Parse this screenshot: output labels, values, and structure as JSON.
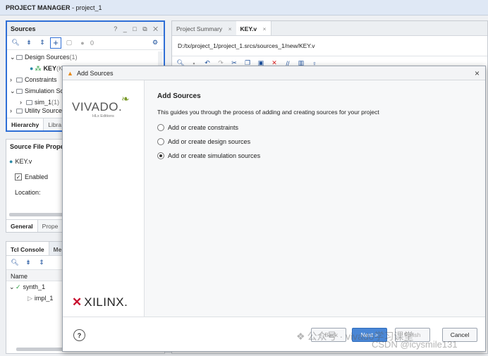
{
  "titlebar": {
    "app": "PROJECT MANAGER",
    "project": " - project_1"
  },
  "sources": {
    "title": "Sources",
    "header_icons": [
      "?",
      "_",
      "□",
      "⧉",
      "✕"
    ],
    "badge_count": "0",
    "tree": [
      {
        "label": "Design Sources",
        "suffix": " (1)"
      },
      {
        "label": "KEY",
        "suffix": " (K"
      },
      {
        "label": "Constraints",
        "suffix": ""
      },
      {
        "label": "Simulation Sc",
        "suffix": ""
      },
      {
        "label": "sim_1",
        "suffix": " (1)"
      },
      {
        "label": "Utility Source",
        "suffix": ""
      }
    ],
    "tabs": [
      "Hierarchy",
      "Libra"
    ]
  },
  "props": {
    "title": "Source File Proper",
    "file": "KEY.v",
    "enabled_label": "Enabled",
    "location_label": "Location:",
    "tabs": [
      "General",
      "Prope"
    ]
  },
  "tcl": {
    "tabs": [
      "Tcl Console",
      "Me"
    ],
    "column": "Name",
    "runs": [
      {
        "label": "synth_1"
      },
      {
        "label": "impl_1"
      }
    ]
  },
  "editor": {
    "tabs": [
      "Project Summary",
      "KEY.v"
    ],
    "path": "D:/tx/project_1/project_1.srcs/sources_1/new/KEY.v"
  },
  "dialog": {
    "title": "Add Sources",
    "heading": "Add Sources",
    "description": "This guides you through the process of adding and creating sources for your project",
    "options": [
      {
        "label": "Add or create constraints",
        "checked": false
      },
      {
        "label": "Add or create design sources",
        "checked": false
      },
      {
        "label": "Add or create simulation sources",
        "checked": true
      }
    ],
    "vivado_logo": "VIVADO.",
    "vivado_sub": "HLx Editions",
    "xilinx_logo": "XILINX.",
    "help": "?",
    "back_label": "< Back",
    "next_label": "Next >",
    "finish_label": "Finish",
    "cancel_label": "Cancel"
  },
  "watermark": {
    "wechat": "公众号 · vivado学习课堂",
    "csdn": "CSDN @icysmile131"
  },
  "colors": {
    "accent": "#1a4f9c",
    "selection_border": "#2f6fd6",
    "xilinx_red": "#c8102e",
    "check_green": "#2ea043"
  }
}
